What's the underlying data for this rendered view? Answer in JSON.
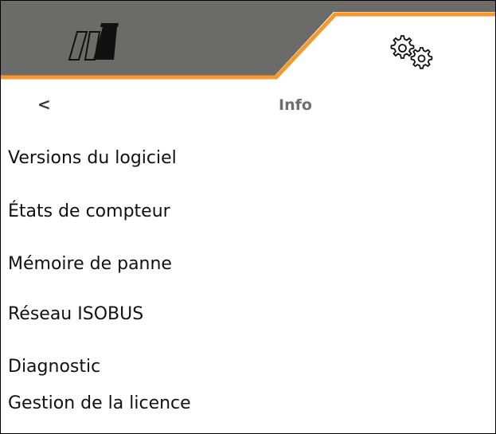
{
  "tabs": [
    {
      "icon": "field-tramline-icon",
      "active": false
    },
    {
      "icon": "gears-icon",
      "active": true
    }
  ],
  "colors": {
    "tab_inactive": "#6b6b69",
    "accent": "#f59a2a",
    "background": "#ffffff",
    "title": "#6f6f6f"
  },
  "header": {
    "back_label": "<",
    "title": "Info"
  },
  "menu": [
    {
      "label": "Versions du logiciel"
    },
    {
      "label": "États de compteur"
    },
    {
      "label": "Mémoire de panne"
    },
    {
      "label": "Réseau ISOBUS"
    },
    {
      "label": "Diagnostic"
    },
    {
      "label": "Gestion de la licence"
    }
  ]
}
